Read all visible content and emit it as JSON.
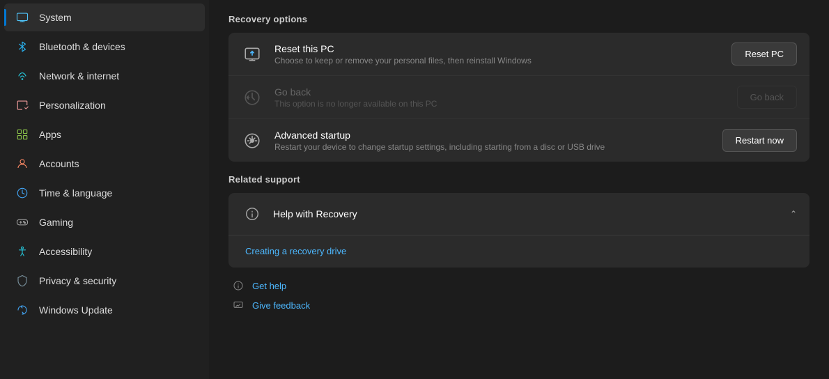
{
  "sidebar": {
    "items": [
      {
        "id": "system",
        "label": "System",
        "icon": "💻",
        "iconClass": "icon-system",
        "active": true
      },
      {
        "id": "bluetooth",
        "label": "Bluetooth & devices",
        "icon": "🔵",
        "iconClass": "icon-bluetooth",
        "active": false
      },
      {
        "id": "network",
        "label": "Network & internet",
        "icon": "🌐",
        "iconClass": "icon-network",
        "active": false
      },
      {
        "id": "personalization",
        "label": "Personalization",
        "icon": "✏️",
        "iconClass": "icon-personalization",
        "active": false
      },
      {
        "id": "apps",
        "label": "Apps",
        "icon": "📦",
        "iconClass": "icon-apps",
        "active": false
      },
      {
        "id": "accounts",
        "label": "Accounts",
        "icon": "👤",
        "iconClass": "icon-accounts",
        "active": false
      },
      {
        "id": "time",
        "label": "Time & language",
        "icon": "🕐",
        "iconClass": "icon-time",
        "active": false
      },
      {
        "id": "gaming",
        "label": "Gaming",
        "icon": "🎮",
        "iconClass": "icon-gaming",
        "active": false
      },
      {
        "id": "accessibility",
        "label": "Accessibility",
        "icon": "♿",
        "iconClass": "icon-accessibility",
        "active": false
      },
      {
        "id": "privacy",
        "label": "Privacy & security",
        "icon": "🛡️",
        "iconClass": "icon-privacy",
        "active": false
      },
      {
        "id": "update",
        "label": "Windows Update",
        "icon": "🔄",
        "iconClass": "icon-update",
        "active": false
      }
    ]
  },
  "main": {
    "recovery_options_title": "Recovery options",
    "reset_title": "Reset this PC",
    "reset_desc": "Choose to keep or remove your personal files, then reinstall Windows",
    "reset_btn": "Reset PC",
    "goback_title": "Go back",
    "goback_desc": "This option is no longer available on this PC",
    "goback_btn": "Go back",
    "advanced_title": "Advanced startup",
    "advanced_desc": "Restart your device to change startup settings, including starting from a disc or USB drive",
    "advanced_btn": "Restart now",
    "related_support_title": "Related support",
    "help_recovery_label": "Help with Recovery",
    "creating_recovery_link": "Creating a recovery drive",
    "get_help_link": "Get help",
    "give_feedback_link": "Give feedback"
  }
}
